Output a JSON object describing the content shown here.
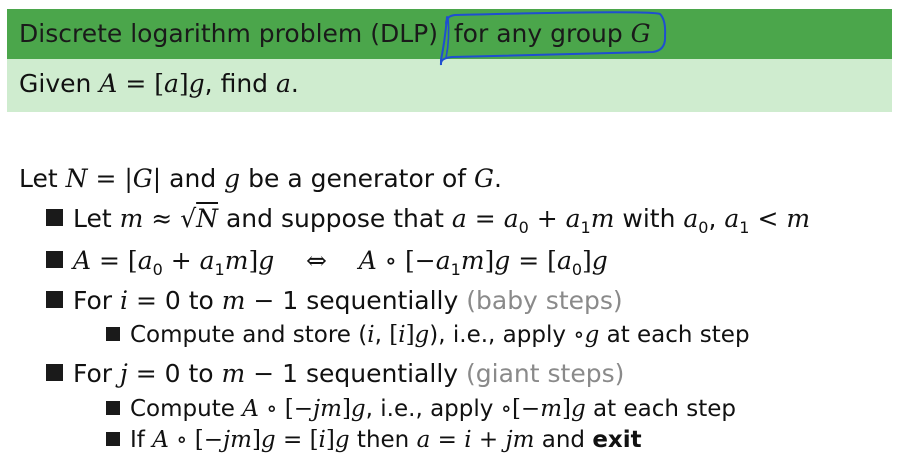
{
  "block": {
    "title_text": "Discrete logarithm problem (DLP)",
    "title_annotated": "for any group G",
    "given": "Given A = [a]g, find a."
  },
  "intro": "Let N = |G| and g be a generator of G.",
  "bullets": [
    "Let m ≈ √N and suppose that a = a₀ + a₁m with a₀, a₁ < m",
    "A = [a₀ + a₁m]g   ⇔   A ∘ [−a₁m]g = [a₀]g",
    "For i = 0 to m − 1 sequentially (baby steps)",
    "Compute and store (i, [i]g), i.e., apply ∘g at each step",
    "For j = 0 to m − 1 sequentially (giant steps)",
    "Compute A ∘ [−jm]g, i.e., apply ∘[−m]g at each step",
    "If A ∘ [−jm]g = [i]g then a = i + jm and exit"
  ],
  "colors": {
    "header_green": "#4ba64b",
    "body_green": "#cfeccf",
    "annotation_blue": "#1f4fd0",
    "muted_gray": "#8a8a8a"
  }
}
